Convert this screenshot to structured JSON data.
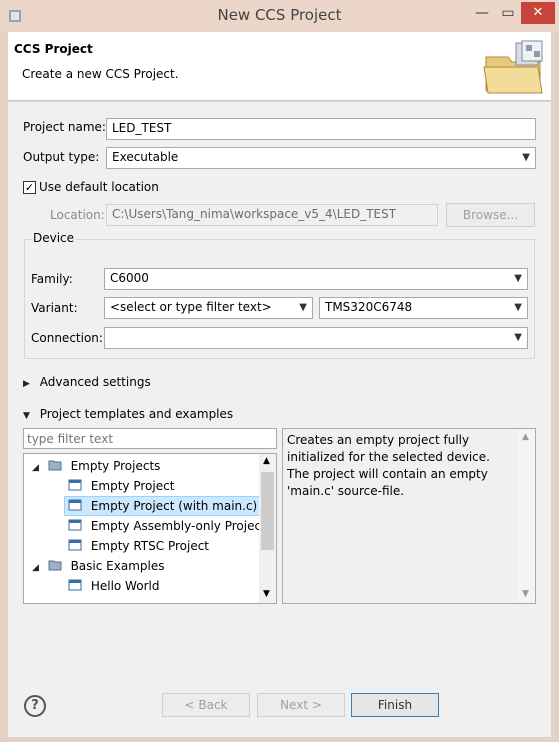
{
  "window": {
    "title": "New CCS Project",
    "minimize": "—",
    "maximize": "▭",
    "close": "✕"
  },
  "header": {
    "title": "CCS Project",
    "subtitle": "Create a new CCS Project."
  },
  "project": {
    "name_label": "Project name:",
    "name_value": "LED_TEST",
    "output_label": "Output type:",
    "output_value": "Executable",
    "use_default_label": "Use default location",
    "use_default_checked": true,
    "location_label": "Location:",
    "location_value": "C:\\Users\\Tang_nima\\workspace_v5_4\\LED_TEST",
    "browse_label": "Browse..."
  },
  "device": {
    "group_label": "Device",
    "family_label": "Family:",
    "family_value": "C6000",
    "variant_label": "Variant:",
    "variant_filter_placeholder": "<select or type filter text>",
    "variant_value": "TMS320C6748",
    "connection_label": "Connection:",
    "connection_value": ""
  },
  "sections": {
    "advanced": "Advanced settings",
    "templates": "Project templates and examples"
  },
  "templates": {
    "filter_placeholder": "type filter text",
    "tree": [
      {
        "label": "Empty Projects",
        "level": 0,
        "expanded": true
      },
      {
        "label": "Empty Project",
        "level": 1
      },
      {
        "label": "Empty Project (with main.c)",
        "level": 1,
        "selected": true
      },
      {
        "label": "Empty Assembly-only Project",
        "level": 1
      },
      {
        "label": "Empty RTSC Project",
        "level": 1
      },
      {
        "label": "Basic Examples",
        "level": 0,
        "expanded": true
      },
      {
        "label": "Hello World",
        "level": 1
      }
    ],
    "description": "Creates an empty project fully initialized for the selected device. The project will contain an empty 'main.c' source-file."
  },
  "buttons": {
    "back": "< Back",
    "next": "Next >",
    "finish": "Finish"
  },
  "colors": {
    "titlebar": "#ebd6c9",
    "close": "#c7443a",
    "selection": "#cce8ff"
  }
}
